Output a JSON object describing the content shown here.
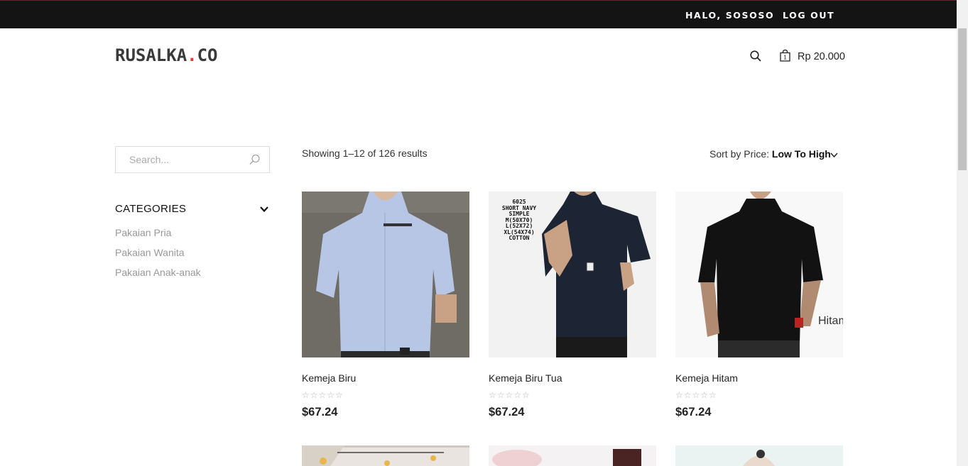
{
  "topbar": {
    "greeting": "HALO, SOSOSO",
    "logout": "LOG OUT"
  },
  "brand": {
    "name": "RUSALKA",
    "dot": ".",
    "suffix": "CO"
  },
  "header": {
    "cart_count": "1",
    "cart_total": "Rp 20.000"
  },
  "sidebar": {
    "search_placeholder": "Search...",
    "categories_title": "CATEGORIES",
    "categories": [
      "Pakaian Pria",
      "Pakaian Wanita",
      "Pakaian Anak-anak"
    ]
  },
  "listing": {
    "showing": "Showing 1–12 of 126 results",
    "sort_label": "Sort by Price:",
    "sort_value": "Low To High"
  },
  "products": [
    {
      "name": "Kemeja Biru",
      "price": "$67.24",
      "rating": 0
    },
    {
      "name": "Kemeja Biru Tua",
      "price": "$67.24",
      "rating": 0,
      "overlay": [
        "6025",
        "SHORT NAVY",
        "SIMPLE",
        "M(50X70)",
        "L(52X72)",
        "XL(54X74)",
        "COTTON"
      ]
    },
    {
      "name": "Kemeja Hitam",
      "price": "$67.24",
      "rating": 0,
      "overlay_label": "Hitam"
    }
  ],
  "colors": {
    "accent": "#e03a3a",
    "topbar": "#141414"
  }
}
